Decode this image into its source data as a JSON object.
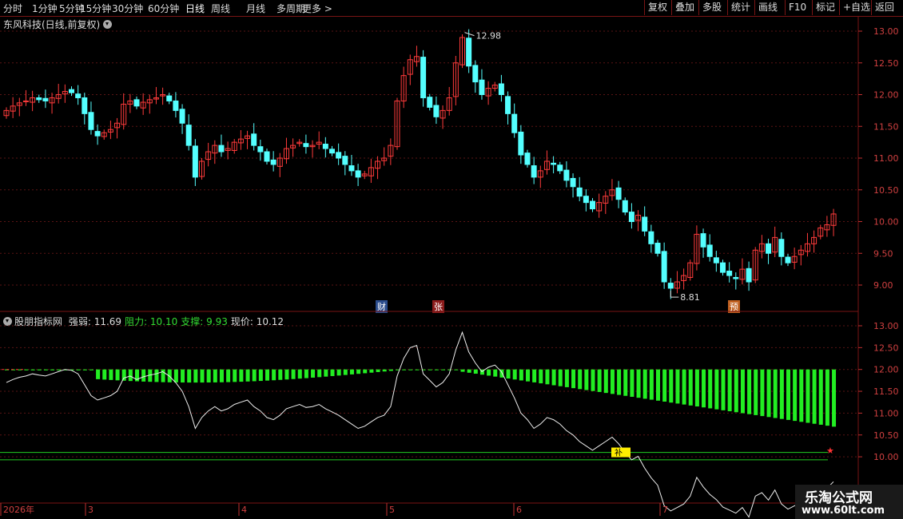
{
  "toolbar": {
    "periods": [
      "分时",
      "1分钟",
      "5分钟",
      "15分钟",
      "30分钟",
      "60分钟",
      "日线",
      "周线",
      "月线",
      "多周期",
      "更多 >"
    ],
    "active_period": "日线",
    "buttons": [
      "复权",
      "叠加",
      "多股",
      "统计",
      "画线",
      "F10",
      "标记",
      "+自选",
      "返回"
    ]
  },
  "main_chart": {
    "title": "东风科技(日线,前复权)",
    "y_ticks": [
      "13.00",
      "12.50",
      "12.00",
      "11.50",
      "11.00",
      "10.50",
      "10.00",
      "9.50",
      "9.00"
    ],
    "high_label": "12.98",
    "low_label": "8.81",
    "events": [
      {
        "text": "财",
        "color": "#2a4c8c"
      },
      {
        "text": "张",
        "color": "#8c1c1c"
      },
      {
        "text": "预",
        "color": "#c06020"
      }
    ]
  },
  "indicator": {
    "name": "股朋指标网",
    "items": [
      {
        "label": "强弱: 11.69",
        "color": "#dddddd"
      },
      {
        "label": "阻力: 10.10",
        "color": "#33dd33"
      },
      {
        "label": "支撑: 9.93",
        "color": "#33dd33"
      },
      {
        "label": "现价: 10.12",
        "color": "#dddddd"
      }
    ],
    "y_ticks": [
      "13.00",
      "12.50",
      "12.00",
      "11.50",
      "11.00",
      "10.50",
      "10.00"
    ],
    "signal_text": "补"
  },
  "x_axis": {
    "labels": [
      "2026年",
      "3",
      "4",
      "5",
      "6",
      "7"
    ]
  },
  "watermark": {
    "line1": "乐淘公式网",
    "line2": "www.60lt.com"
  },
  "chart_data": {
    "type": "candlestick",
    "ylim": [
      8.75,
      13.1
    ],
    "up_color": "#ff3b3b",
    "down_color": "#54ffff",
    "close": [
      11.75,
      11.82,
      11.87,
      11.9,
      11.95,
      11.92,
      11.9,
      11.95,
      12.0,
      12.05,
      12.03,
      11.95,
      11.7,
      11.45,
      11.35,
      11.4,
      11.45,
      11.55,
      11.85,
      11.9,
      11.82,
      11.88,
      11.92,
      11.95,
      12.0,
      11.9,
      11.75,
      11.55,
      11.2,
      10.7,
      10.95,
      11.1,
      11.2,
      11.1,
      11.15,
      11.25,
      11.3,
      11.35,
      11.2,
      11.1,
      10.95,
      10.9,
      11.0,
      11.15,
      11.2,
      11.25,
      11.18,
      11.2,
      11.25,
      11.15,
      11.08,
      11.0,
      10.9,
      10.8,
      10.7,
      10.75,
      10.85,
      10.95,
      11.0,
      11.2,
      11.9,
      12.3,
      12.55,
      12.6,
      11.95,
      11.8,
      11.65,
      11.75,
      11.95,
      12.5,
      12.9,
      12.45,
      12.2,
      12.0,
      12.1,
      12.15,
      12.0,
      11.7,
      11.4,
      11.05,
      10.9,
      10.7,
      10.8,
      10.95,
      10.9,
      10.8,
      10.65,
      10.55,
      10.4,
      10.3,
      10.2,
      10.3,
      10.4,
      10.5,
      10.35,
      10.15,
      10.0,
      10.1,
      9.85,
      9.65,
      9.5,
      9.05,
      8.95,
      9.05,
      9.15,
      9.35,
      9.8,
      9.6,
      9.45,
      9.35,
      9.2,
      9.15,
      9.1,
      9.25,
      9.05,
      9.55,
      9.65,
      9.5,
      9.75,
      9.45,
      9.35,
      9.45,
      9.55,
      9.65,
      9.75,
      9.9,
      9.95,
      10.12
    ],
    "indicator_strength": [
      11.69
    ],
    "indicator_resistance": [
      10.1
    ],
    "indicator_support": [
      9.93
    ]
  }
}
